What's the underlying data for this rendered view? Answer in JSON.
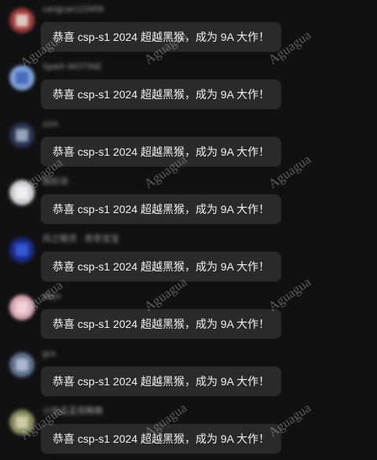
{
  "messages": [
    {
      "username": "cangcan123456",
      "text": "恭喜 csp-s1 2024 超越黑猴，成为 9A 大作！",
      "avatar_bg": "#9e3b3b",
      "avatar_fg": "#e8e2d6"
    },
    {
      "username": "Spark WOTINE",
      "text": "恭喜 csp-s1 2024 超越黑猴，成为 9A 大作！",
      "avatar_bg": "#7fa2d9",
      "avatar_fg": "#3d63b5"
    },
    {
      "username": "zzm",
      "text": "恭喜 csp-s1 2024 超越黑猴，成为 9A 大作！",
      "avatar_bg": "#2a3550",
      "avatar_fg": "#a9b6cf"
    },
    {
      "username": "图标说",
      "text": "恭喜 csp-s1 2024 超越黑猴，成为 9A 大作！",
      "avatar_bg": "#cfd0d6",
      "avatar_fg": "#f5f5f5"
    },
    {
      "username": "风之精灵 · 奇奇宝宝",
      "text": "恭喜 csp-s1 2024 超越黑猴，成为 9A 大作！",
      "avatar_bg": "#1b2b86",
      "avatar_fg": "#3a62e0"
    },
    {
      "username": "sbyo",
      "text": "恭喜 csp-s1 2024 超越黑猴，成为 9A 大作！",
      "avatar_bg": "#d9a8b0",
      "avatar_fg": "#f3d9dd"
    },
    {
      "username": "gcx",
      "text": "恭喜 csp-s1 2024 超越黑猴，成为 9A 大作！",
      "avatar_bg": "#5e6e8a",
      "avatar_fg": "#b8c4d6"
    },
    {
      "username": "小张孟孟很瞧瞧",
      "text": "恭喜 csp-s1 2024 超越黑猴，成为 9A 大作！",
      "avatar_bg": "#8a8a60",
      "avatar_fg": "#d8d6b0"
    }
  ],
  "watermark": "Aguagua"
}
